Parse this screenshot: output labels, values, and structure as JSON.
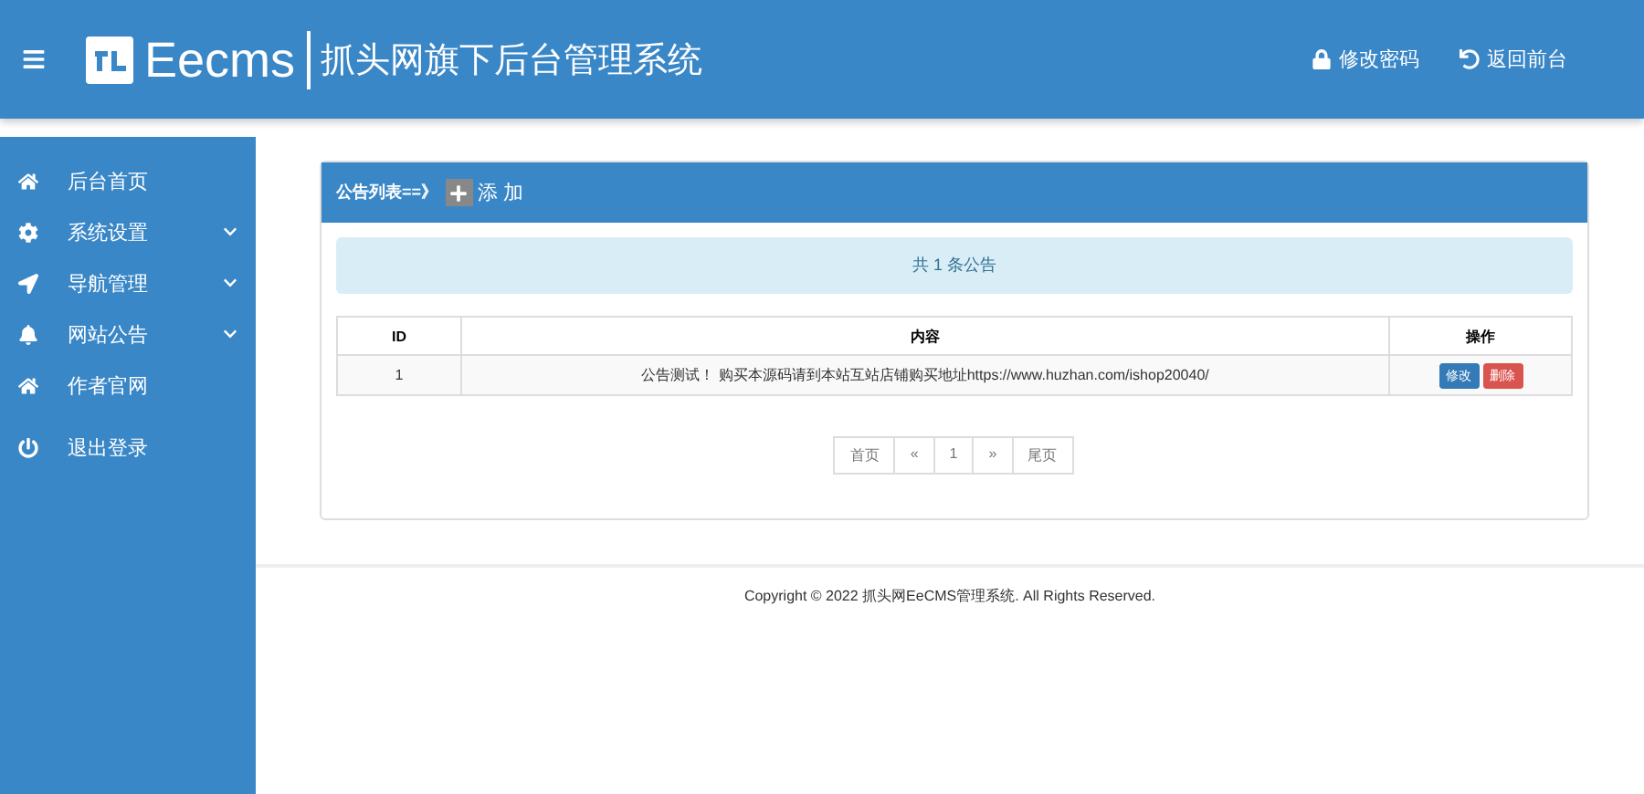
{
  "header": {
    "logo": "Eecms",
    "title": "抓头网旗下后台管理系统",
    "links": [
      {
        "kind": "lock",
        "label": "修改密码"
      },
      {
        "kind": "undo",
        "label": "返回前台"
      }
    ]
  },
  "sidebar": {
    "items": [
      {
        "kind": "home",
        "label": "后台首页",
        "has_submenu": false
      },
      {
        "kind": "gear",
        "label": "系统设置",
        "has_submenu": true
      },
      {
        "kind": "navigation",
        "label": "导航管理",
        "has_submenu": true
      },
      {
        "kind": "bell",
        "label": "网站公告",
        "has_submenu": true
      },
      {
        "kind": "home",
        "label": "作者官网",
        "has_submenu": false
      },
      {
        "kind": "power",
        "label": "退出登录",
        "has_submenu": false
      }
    ]
  },
  "panel": {
    "title": "公告列表==》",
    "add_label": "添 加",
    "summary": "共 1 条公告",
    "table": {
      "columns": [
        "ID",
        "内容",
        "操作"
      ],
      "rows": [
        {
          "id": "1",
          "content": "公告测试！ 购买本源码请到本站互站店铺购买地址https://www.huzhan.com/ishop20040/",
          "actions": [
            {
              "kind": "edit",
              "label": "修改"
            },
            {
              "kind": "delete",
              "label": "删除"
            }
          ]
        }
      ]
    },
    "pagination": [
      "首页",
      "«",
      "1",
      "»",
      "尾页"
    ]
  },
  "footer": {
    "copyright": "Copyright © 2022 抓头网EeCMS管理系统. All Rights Reserved."
  }
}
